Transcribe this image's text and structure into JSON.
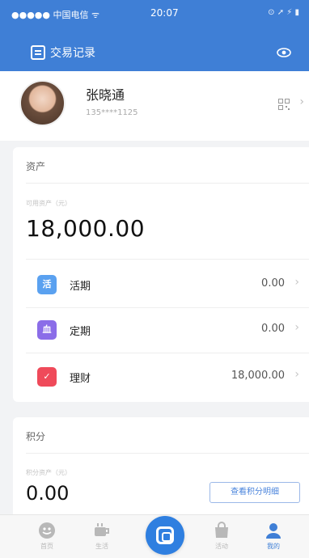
{
  "status_bar": {
    "carrier": "●●●●● 中国电信 ᯤ",
    "time": "20:07",
    "right": "⊙ ➚ ⚡ ▮"
  },
  "nav": {
    "title": "交易记录"
  },
  "profile": {
    "name": "张晓通",
    "phone": "135****1125"
  },
  "assets": {
    "title": "资产",
    "subtitle": "可用资产（元）",
    "total": "18,000.00",
    "rows": [
      {
        "label": "活期",
        "value": "0.00",
        "icon": "demand-deposit-icon",
        "color": "#5aa1f0"
      },
      {
        "label": "定期",
        "value": "0.00",
        "icon": "fixed-deposit-icon",
        "color": "#8b6de8"
      },
      {
        "label": "理财",
        "value": "18,000.00",
        "icon": "wealth-management-icon",
        "color": "#ef4a5a"
      }
    ]
  },
  "points": {
    "title": "积分",
    "subtitle": "积分资产（元）",
    "amount": "0.00",
    "button": "查看积分明细"
  },
  "tabs": [
    {
      "label": "首页",
      "icon": "home-icon"
    },
    {
      "label": "生活",
      "icon": "coffee-icon"
    },
    {
      "label": "",
      "icon": "scan-center-icon"
    },
    {
      "label": "活动",
      "icon": "bag-icon"
    },
    {
      "label": "我的",
      "icon": "user-icon"
    }
  ]
}
